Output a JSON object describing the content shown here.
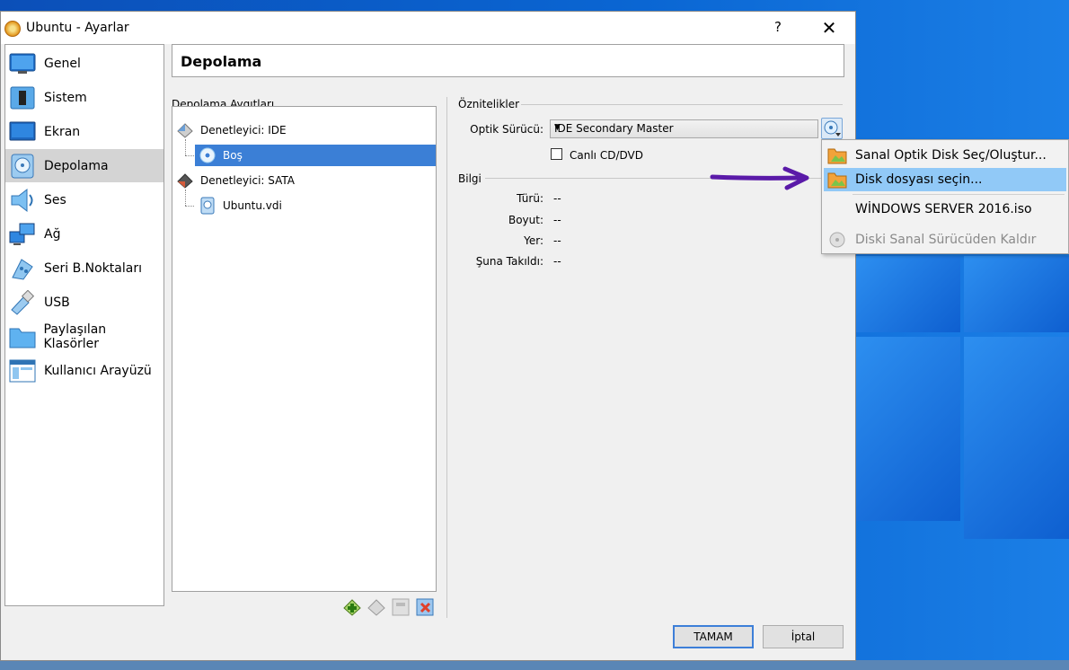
{
  "window": {
    "title": "Ubuntu - Ayarlar",
    "help_glyph": "?",
    "close_glyph": "✕"
  },
  "sidebar": {
    "items": [
      {
        "label": "Genel",
        "icon": "monitor-icon",
        "active": false
      },
      {
        "label": "Sistem",
        "icon": "chip-icon",
        "active": false
      },
      {
        "label": "Ekran",
        "icon": "display-icon",
        "active": false
      },
      {
        "label": "Depolama",
        "icon": "storage-disk-icon",
        "active": true
      },
      {
        "label": "Ses",
        "icon": "speaker-icon",
        "active": false
      },
      {
        "label": "Ağ",
        "icon": "network-icon",
        "active": false
      },
      {
        "label": "Seri B.Noktaları",
        "icon": "serial-port-icon",
        "active": false
      },
      {
        "label": "USB",
        "icon": "usb-icon",
        "active": false
      },
      {
        "label": "Paylaşılan Klasörler",
        "icon": "folder-icon",
        "active": false
      },
      {
        "label": "Kullanıcı Arayüzü",
        "icon": "ui-window-icon",
        "active": false
      }
    ]
  },
  "page": {
    "heading": "Depolama"
  },
  "storage": {
    "section_label": "Depolama Aygıtları",
    "tree": {
      "controller_ide": "Denetleyici: IDE",
      "ide_child": "Boş",
      "controller_sata": "Denetleyici: SATA",
      "sata_child": "Ubuntu.vdi"
    },
    "toolbar": {
      "add_controller": "add-controller-icon",
      "remove_controller": "remove-controller-icon",
      "add_attachment": "add-attachment-icon",
      "remove_attachment": "remove-attachment-icon"
    }
  },
  "attributes": {
    "section_label": "Öznitelikler",
    "optical_drive_label": "Optik Sürücü:",
    "optical_drive_value": "IDE Secondary Master",
    "live_cd_label": "Canlı CD/DVD",
    "live_cd_checked": false
  },
  "info": {
    "section_label": "Bilgi",
    "rows": [
      {
        "label": "Türü:",
        "value": "--"
      },
      {
        "label": "Boyut:",
        "value": "--"
      },
      {
        "label": "Yer:",
        "value": "--"
      },
      {
        "label": "Şuna Takıldı:",
        "value": "--"
      }
    ]
  },
  "menu": {
    "items": [
      {
        "label": "Sanal Optik Disk Seç/Oluştur...",
        "icon": "folder-image-icon",
        "highlighted": false,
        "disabled": false
      },
      {
        "label": "Disk dosyası seçin...",
        "icon": "folder-image-icon",
        "highlighted": true,
        "disabled": false
      },
      {
        "label": "WİNDOWS SERVER 2016.iso",
        "icon": "",
        "highlighted": false,
        "disabled": false
      },
      {
        "label": "Diski Sanal Sürücüden Kaldır",
        "icon": "eject-disc-icon",
        "highlighted": false,
        "disabled": true
      }
    ]
  },
  "buttons": {
    "ok": "TAMAM",
    "cancel": "İptal"
  },
  "colors": {
    "selection": "#3b7fd6",
    "menu_highlight": "#91c9f7",
    "annotation_arrow": "#5a1aa8",
    "desktop_blue": "#0a66d3"
  }
}
